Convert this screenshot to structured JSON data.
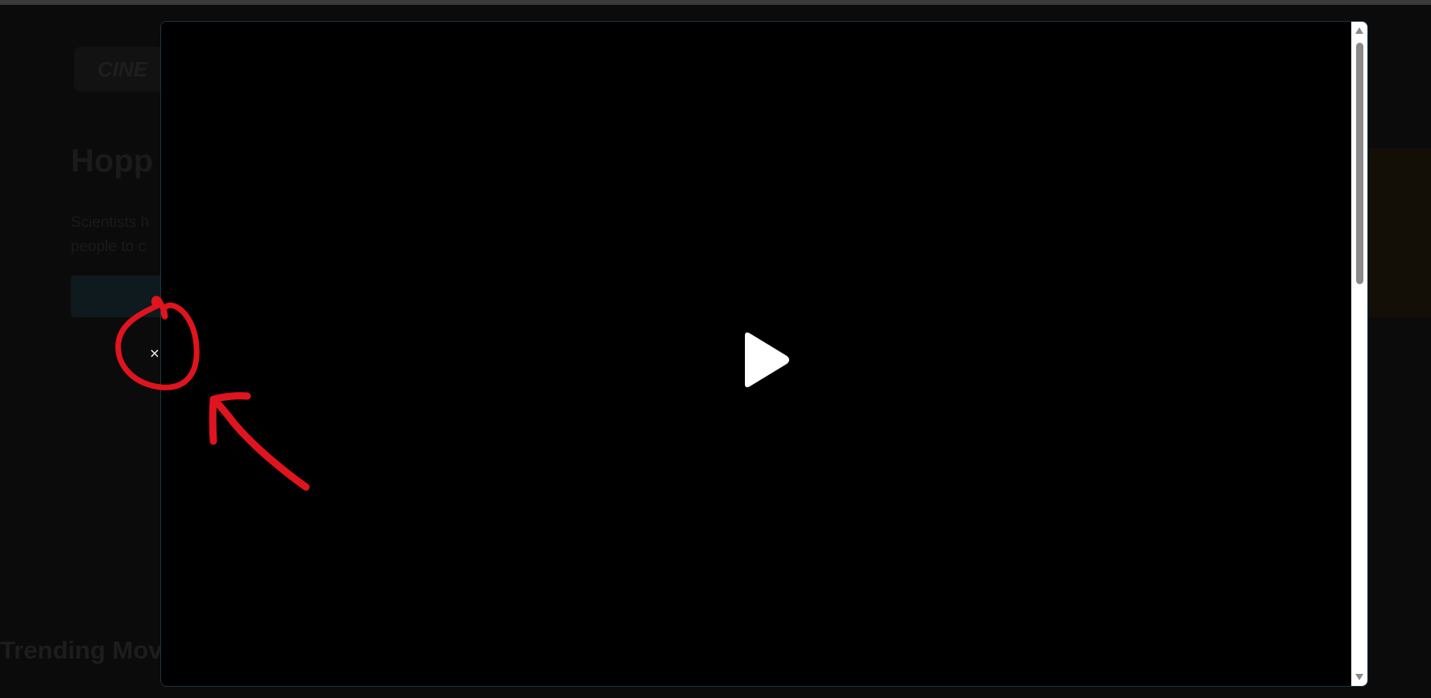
{
  "background_page": {
    "logo_text": "CINE",
    "hero_title": "Hopp",
    "hero_text_lines": [
      "Scientists h",
      "people to c"
    ],
    "hero_button_label": "",
    "trending_heading": "Trending Mov"
  },
  "modal": {
    "close_label": "×",
    "play_icon": "play-icon",
    "scroll_up_icon": "scroll-up-arrow-icon",
    "scroll_down_icon": "scroll-down-arrow-icon"
  },
  "annotation": {
    "color": "#e0141e",
    "shapes": [
      "circle-around-close",
      "arrow-pointing-to-close"
    ]
  }
}
